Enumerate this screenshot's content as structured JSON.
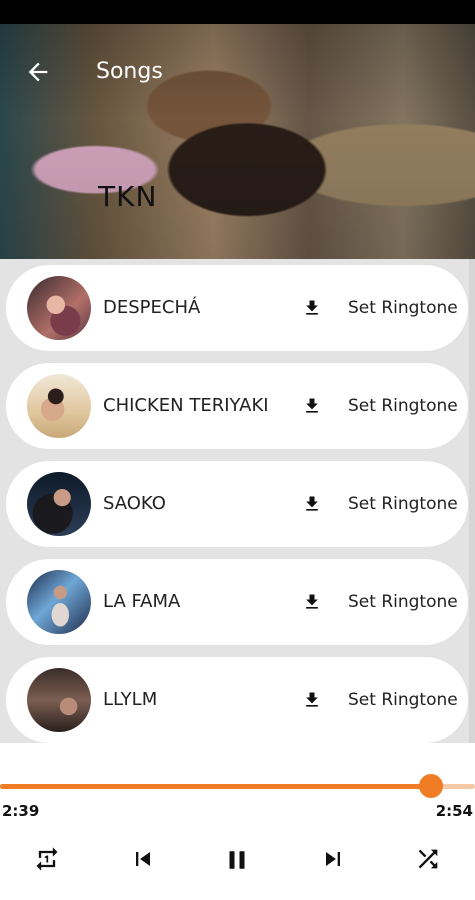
{
  "header": {
    "title": "Songs",
    "artist": "TKN"
  },
  "songs": [
    {
      "title": "DESPECHÁ",
      "action": "Set Ringtone"
    },
    {
      "title": "CHICKEN TERIYAKI",
      "action": "Set Ringtone"
    },
    {
      "title": "SAOKO",
      "action": "Set Ringtone"
    },
    {
      "title": "LA FAMA",
      "action": "Set Ringtone"
    },
    {
      "title": "LLYLM",
      "action": "Set Ringtone"
    }
  ],
  "player": {
    "current_time": "2:39",
    "duration": "2:54",
    "progress": 0.908
  },
  "colors": {
    "accent": "#f07d25",
    "list_background": "#e3e3e3"
  },
  "icons": [
    "back-arrow-icon",
    "download-icon",
    "repeat-icon",
    "skip-previous-icon",
    "pause-icon",
    "skip-next-icon",
    "shuffle-icon"
  ]
}
